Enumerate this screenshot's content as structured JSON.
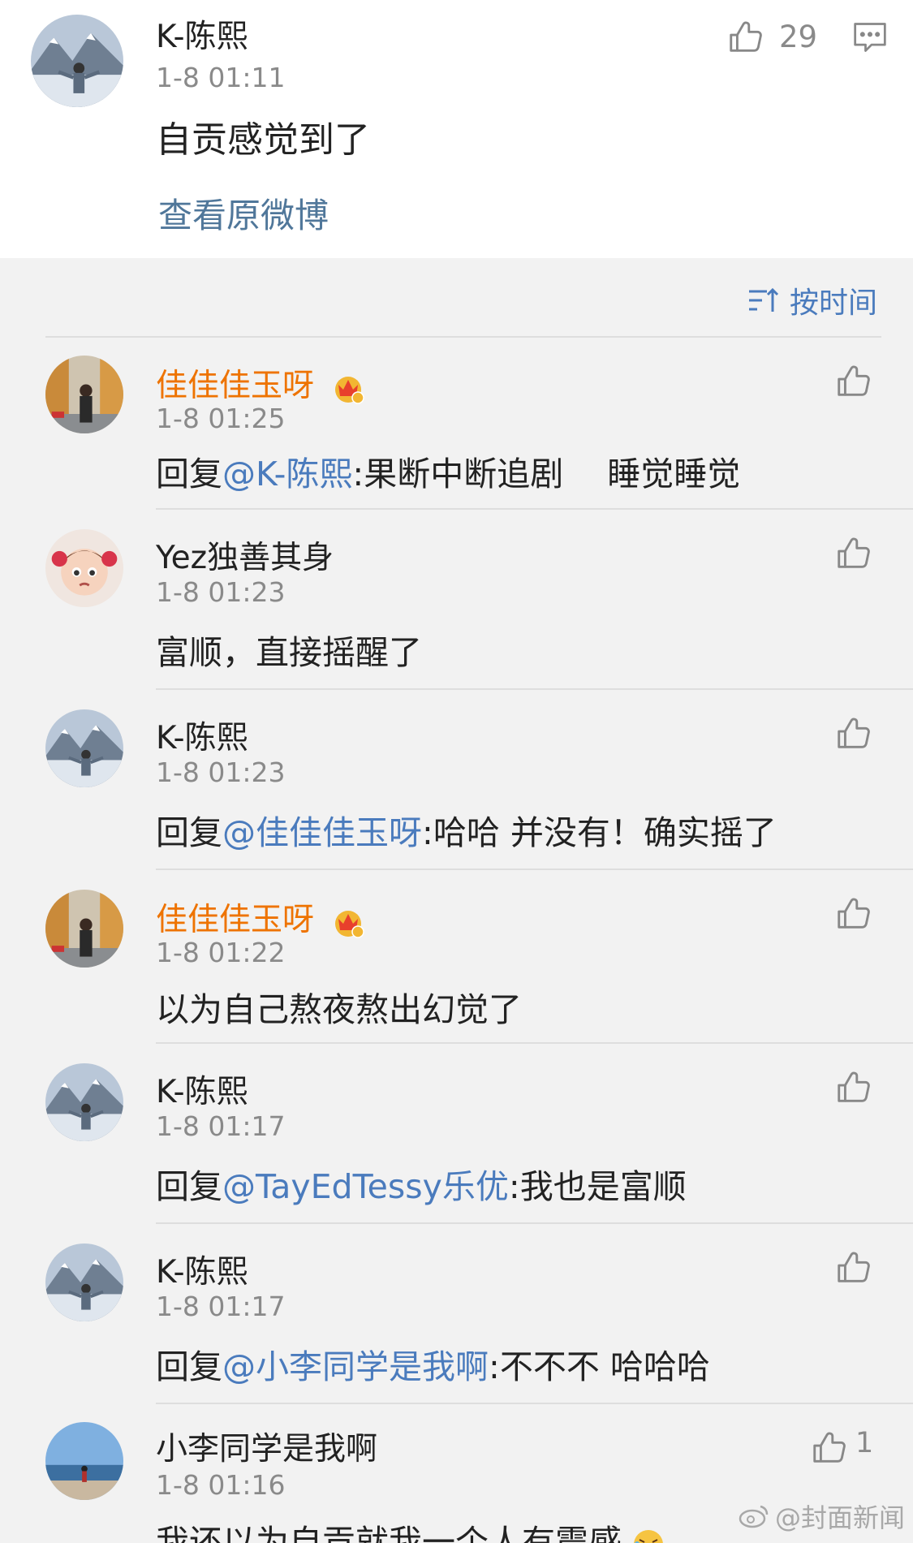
{
  "post": {
    "username": "K-陈熙",
    "time": "1-8 01:11",
    "like_count": "29",
    "text": "自贡感觉到了",
    "view_original": "查看原微博"
  },
  "sort": {
    "label": "按时间"
  },
  "comments": [
    {
      "username": "佳佳佳玉呀",
      "time": "1-8 01:25",
      "prefix": "回复",
      "mention": "@K-陈熙",
      "text": ":果断中断追剧　 睡觉睡觉"
    },
    {
      "username": "Yez独善其身",
      "time": "1-8 01:23",
      "prefix": "",
      "mention": "",
      "text": "富顺，直接摇醒了"
    },
    {
      "username": "K-陈熙",
      "time": "1-8 01:23",
      "prefix": "回复",
      "mention": "@佳佳佳玉呀",
      "text": ":哈哈 并没有！确实摇了"
    },
    {
      "username": "佳佳佳玉呀",
      "time": "1-8 01:22",
      "prefix": "",
      "mention": "",
      "text": "以为自己熬夜熬出幻觉了"
    },
    {
      "username": "K-陈熙",
      "time": "1-8 01:17",
      "prefix": "回复",
      "mention": "@TayEdTessy乐优",
      "text": ":我也是富顺"
    },
    {
      "username": "K-陈熙",
      "time": "1-8 01:17",
      "prefix": "回复",
      "mention": "@小李同学是我啊",
      "text": ":不不不 哈哈哈"
    },
    {
      "username": "小李同学是我啊",
      "time": "1-8 01:16",
      "prefix": "",
      "mention": "",
      "text": "我还以为自贡就我一个人有震感",
      "like_count": "1"
    }
  ],
  "watermark": "@封面新闻",
  "colors": {
    "link": "#4a7bbd",
    "vip_name": "#ee7300",
    "background": "#f2f2f2"
  }
}
